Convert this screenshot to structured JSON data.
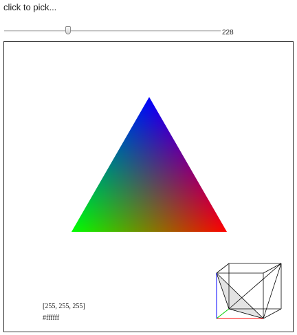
{
  "header": {
    "instruction": "click to pick..."
  },
  "slider": {
    "value": 228,
    "min": 0,
    "max": 255,
    "value_label": "228"
  },
  "picker": {
    "rgb_text": "[255, 255, 255]",
    "hex_text": "#ffffff",
    "colors": {
      "blue": "#0000ff",
      "green": "#00ff00",
      "red": "#ff0000"
    }
  },
  "cube_view": {
    "axis_colors": {
      "x": "#ff0000",
      "y": "#00cc00",
      "z": "#0000ff"
    },
    "edge_color": "#000000",
    "plane_fill": "#e3e3e3"
  }
}
